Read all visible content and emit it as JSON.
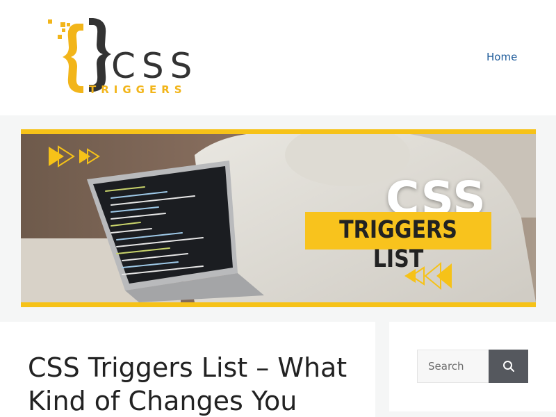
{
  "site": {
    "logo_text": "CSS",
    "logo_subtext": "TRIGGERS",
    "brand_color": "#f2b51a",
    "dark_color": "#333333"
  },
  "nav": {
    "items": [
      {
        "label": "Home"
      }
    ]
  },
  "banner": {
    "heading": "CSS",
    "label": "TRIGGERS LIST",
    "accent_color": "#f6c218"
  },
  "post": {
    "title": "CSS Triggers List – What Kind of Changes You"
  },
  "sidebar": {
    "search": {
      "placeholder": "Search",
      "value": "",
      "button_icon": "search-icon"
    }
  }
}
